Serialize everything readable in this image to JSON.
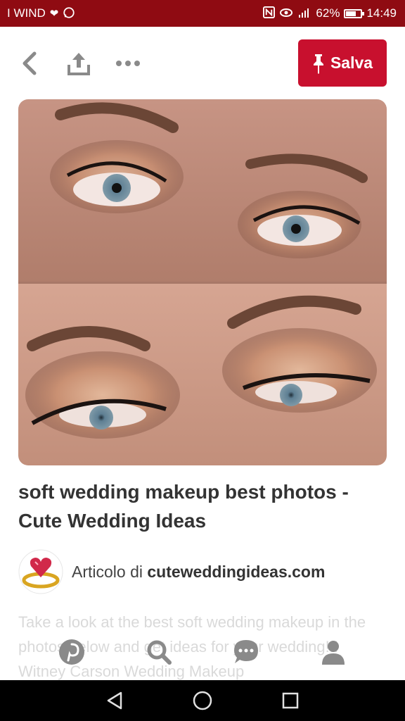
{
  "status_bar": {
    "carrier": "I WIND",
    "battery_percent": "62%",
    "battery_level": 0.62,
    "time": "14:49",
    "icons": [
      "heart-icon",
      "whatsapp-icon",
      "nfc-icon",
      "eye-icon",
      "signal-icon",
      "battery-icon"
    ]
  },
  "toolbar": {
    "save_label": "Salva",
    "icons": [
      "back-arrow-icon",
      "share-upload-icon",
      "more-dots-icon",
      "pin-icon"
    ]
  },
  "pin": {
    "image_alt": "Two close-up photos of eyes with soft wedding makeup",
    "title": "soft wedding makeup best photos - Cute Wedding Ideas",
    "source_prefix": "Articolo di",
    "source_domain": "cuteweddingideas.com",
    "description": "Take a look at the best soft wedding makeup in the photos below and get ideas for your wedding!!! Witney Carson Wedding Makeup"
  },
  "bottom_nav": {
    "icons": [
      "pinterest-icon",
      "search-icon",
      "chat-icon",
      "profile-icon"
    ]
  },
  "system_nav": {
    "icons": [
      "back-triangle-icon",
      "home-circle-icon",
      "recents-square-icon"
    ]
  },
  "colors": {
    "status_bar": "#8f0b12",
    "accent": "#c8102e",
    "text": "#333333",
    "icon_gray": "#8a8a8a"
  }
}
